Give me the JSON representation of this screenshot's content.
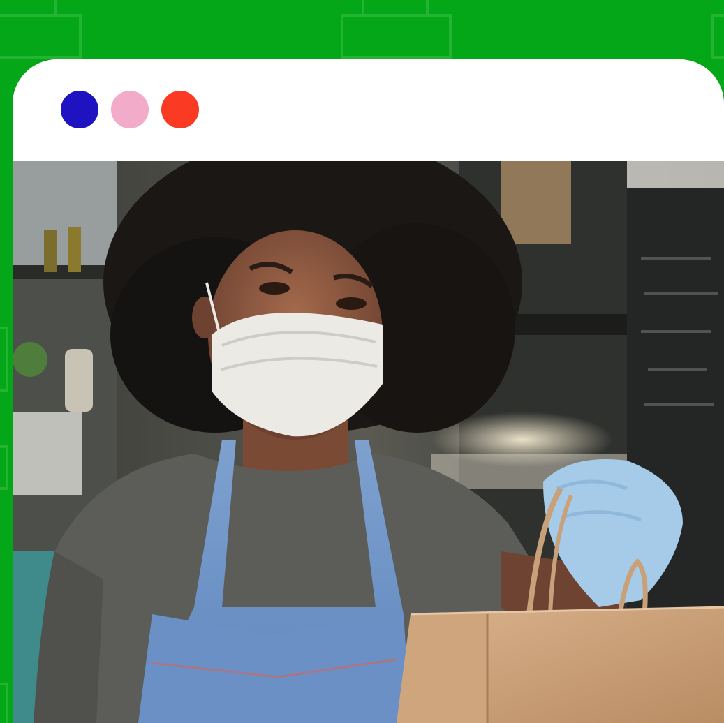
{
  "background": {
    "color": "#04a718",
    "pattern_color": "#2db83a"
  },
  "window": {
    "controls": [
      {
        "name": "close",
        "color": "#1f12c1"
      },
      {
        "name": "minimize",
        "color": "#f2abc8"
      },
      {
        "name": "maximize",
        "color": "#fb3a24"
      }
    ]
  },
  "photo": {
    "icon": "photo-illustration-icon",
    "subject": "worker-in-mask-holding-paper-bag"
  }
}
